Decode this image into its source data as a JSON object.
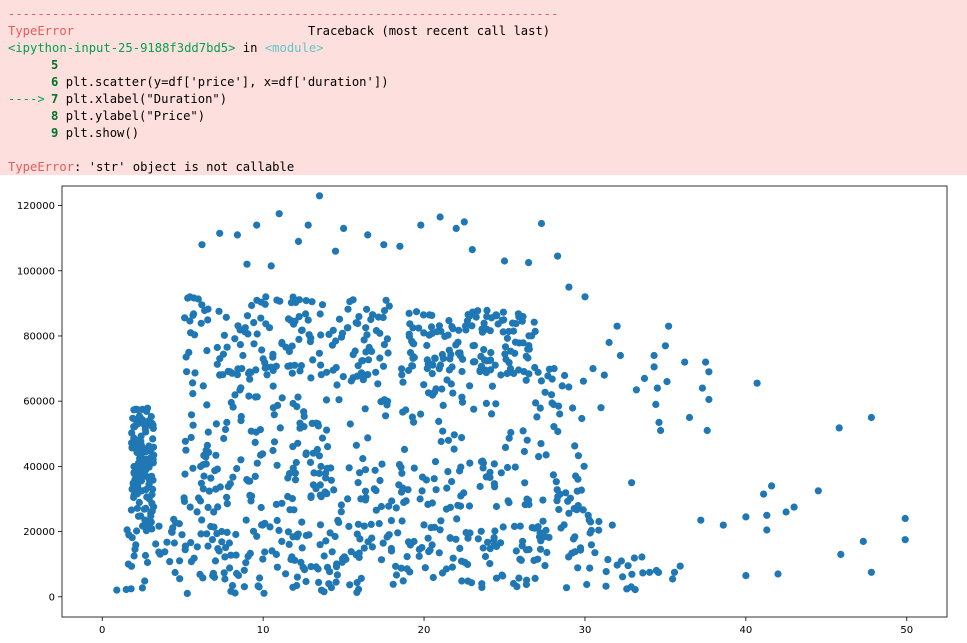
{
  "traceback": {
    "dashes": "---------------------------------------------------------------------------",
    "error_name": "TypeError",
    "header_right": "Traceback (most recent call last)",
    "input_ref": "<ipython-input-25-9188f3dd7bd5>",
    "in_word": " in ",
    "module": "<module>",
    "lines": [
      {
        "arrow": "",
        "num": "5",
        "code": ""
      },
      {
        "arrow": "",
        "num": "6",
        "code": "plt.scatter(y=df['price'], x=df['duration'])"
      },
      {
        "arrow": "---->",
        "num": "7",
        "code": "plt.xlabel(\"Duration\")"
      },
      {
        "arrow": "",
        "num": "8",
        "code": "plt.ylabel(\"Price\")"
      },
      {
        "arrow": "",
        "num": "9",
        "code": "plt.show()"
      }
    ],
    "final_error": "TypeError",
    "final_message": ": 'str' object is not callable"
  },
  "colors": {
    "error_bg": "#fddfdd",
    "marker": "#1f77b4"
  },
  "chart_data": {
    "type": "scatter",
    "title": "",
    "xlabel": "",
    "ylabel": "",
    "xlim": [
      -2.5,
      52.5
    ],
    "ylim": [
      -6200,
      126000
    ],
    "xticks": [
      0,
      10,
      20,
      30,
      40,
      50
    ],
    "yticks": [
      0,
      20000,
      40000,
      60000,
      80000,
      100000,
      120000
    ],
    "grid": false,
    "dense_regions": [
      {
        "x": [
          0.8,
          36
        ],
        "y": [
          1000,
          14000
        ]
      },
      {
        "x": [
          1.5,
          31
        ],
        "y": [
          14000,
          24000
        ]
      },
      {
        "x": [
          1.8,
          3.2
        ],
        "y": [
          20000,
          58000
        ]
      },
      {
        "x": [
          5,
          30
        ],
        "y": [
          40000,
          70000
        ]
      },
      {
        "x": [
          5,
          18
        ],
        "y": [
          68000,
          92000
        ]
      },
      {
        "x": [
          19,
          27
        ],
        "y": [
          68000,
          88000
        ]
      },
      {
        "x": [
          5,
          30
        ],
        "y": [
          26000,
          40000
        ]
      }
    ],
    "points": [
      [
        13.5,
        123000
      ],
      [
        11,
        117500
      ],
      [
        21,
        116500
      ],
      [
        22.5,
        115000
      ],
      [
        27.3,
        114500
      ],
      [
        12.8,
        114000
      ],
      [
        19.8,
        114000
      ],
      [
        9.6,
        114000
      ],
      [
        22,
        113000
      ],
      [
        15,
        113000
      ],
      [
        7.3,
        111500
      ],
      [
        16.5,
        111000
      ],
      [
        8.4,
        111000
      ],
      [
        12.2,
        109000
      ],
      [
        6.2,
        108000
      ],
      [
        17.5,
        108000
      ],
      [
        18.5,
        107500
      ],
      [
        23,
        106500
      ],
      [
        14.5,
        106000
      ],
      [
        28.3,
        104500
      ],
      [
        25,
        103000
      ],
      [
        26.5,
        102500
      ],
      [
        9,
        102000
      ],
      [
        10.5,
        101500
      ],
      [
        29,
        95000
      ],
      [
        30,
        92000
      ],
      [
        32,
        83000
      ],
      [
        35.2,
        83000
      ],
      [
        31.5,
        78000
      ],
      [
        35,
        77000
      ],
      [
        32.2,
        74000
      ],
      [
        34.3,
        74000
      ],
      [
        36.2,
        72000
      ],
      [
        37.5,
        72000
      ],
      [
        34.3,
        70500
      ],
      [
        30.5,
        70000
      ],
      [
        37.7,
        69000
      ],
      [
        31.2,
        68000
      ],
      [
        33.7,
        67000
      ],
      [
        35.1,
        66000
      ],
      [
        40.7,
        65500
      ],
      [
        34.5,
        64000
      ],
      [
        33.2,
        63500
      ],
      [
        37.3,
        64000
      ],
      [
        37.7,
        60500
      ],
      [
        31,
        58000
      ],
      [
        34.4,
        59000
      ],
      [
        36.5,
        55000
      ],
      [
        34.6,
        53500
      ],
      [
        34.7,
        51000
      ],
      [
        37.6,
        51000
      ],
      [
        45.8,
        51800
      ],
      [
        47.8,
        55000
      ],
      [
        32.9,
        35000
      ],
      [
        41.6,
        34000
      ],
      [
        44.5,
        32500
      ],
      [
        41.1,
        31500
      ],
      [
        43,
        27500
      ],
      [
        42.5,
        26000
      ],
      [
        41.3,
        25000
      ],
      [
        40,
        24500
      ],
      [
        49.9,
        24000
      ],
      [
        37.2,
        23500
      ],
      [
        38.6,
        22000
      ],
      [
        41.3,
        20500
      ],
      [
        47.3,
        17000
      ],
      [
        49.9,
        17500
      ],
      [
        45.9,
        13000
      ],
      [
        47.8,
        7500
      ],
      [
        42,
        7000
      ],
      [
        40,
        6500
      ],
      [
        30.2,
        25000
      ],
      [
        29,
        25600
      ],
      [
        31.7,
        22000
      ]
    ]
  }
}
